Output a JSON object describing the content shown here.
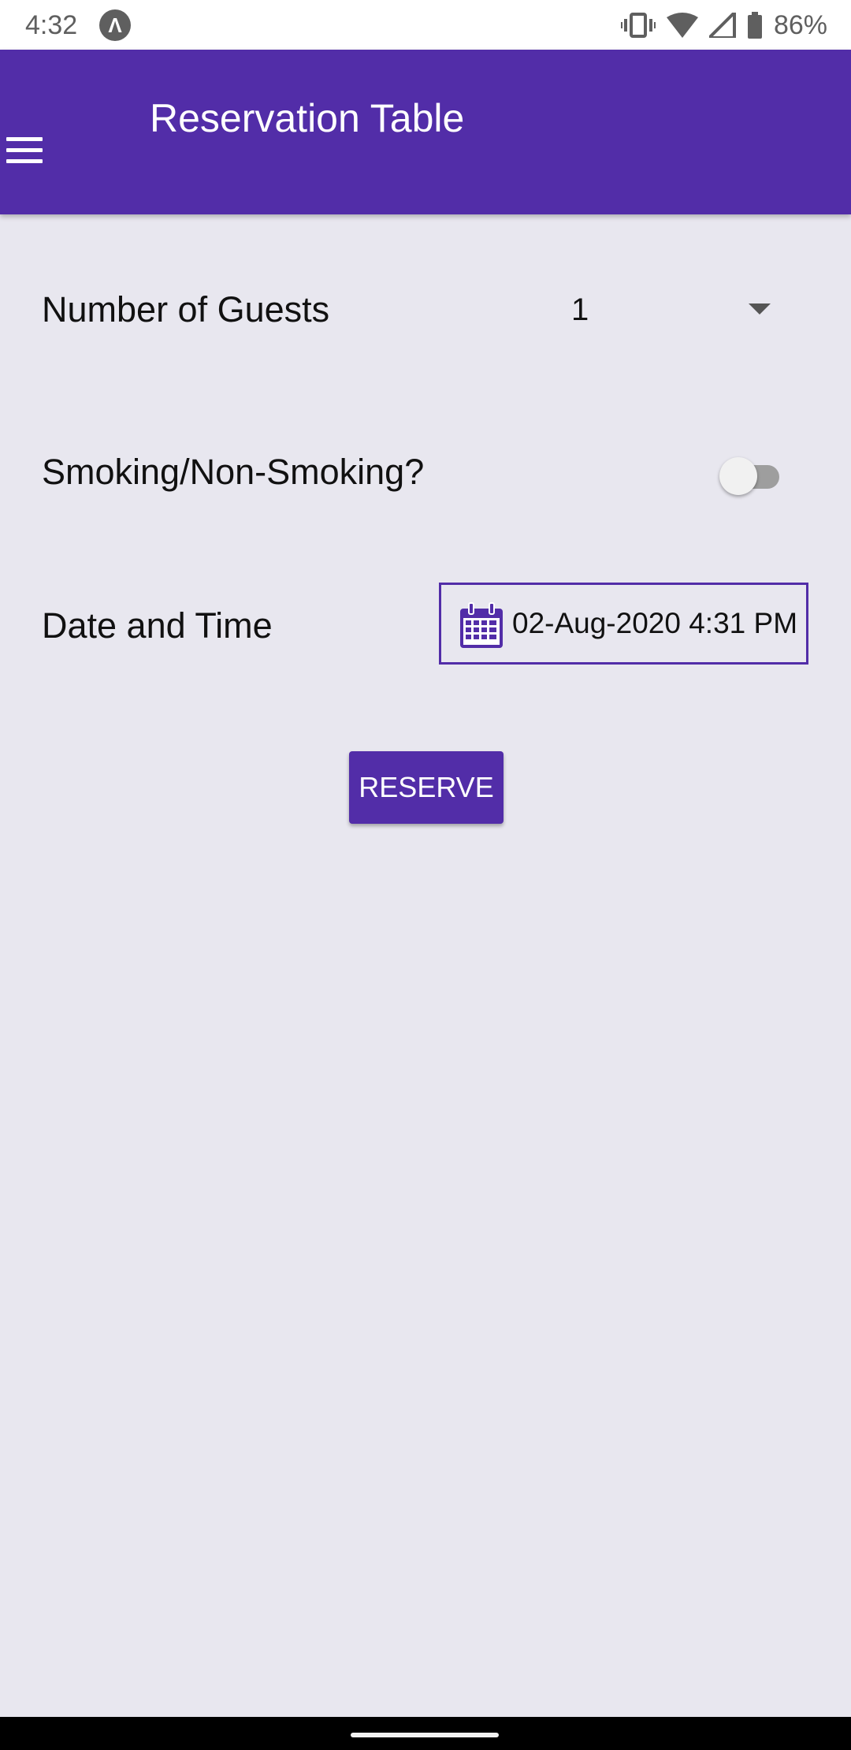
{
  "status_bar": {
    "time": "4:32",
    "app_icon_glyph": "Λ",
    "battery_percent": "86%",
    "icons": [
      "vibrate-icon",
      "wifi-icon",
      "signal-icon",
      "battery-icon"
    ]
  },
  "app_bar": {
    "title": "Reservation Table",
    "menu_icon": "hamburger-menu-icon",
    "background_color": "#522da8"
  },
  "form": {
    "guests": {
      "label": "Number of Guests",
      "selected_value": "1"
    },
    "smoking": {
      "label": "Smoking/Non-Smoking?",
      "checked": false
    },
    "datetime": {
      "label": "Date and Time",
      "value": "02-Aug-2020 4:31 PM",
      "icon": "calendar-icon"
    },
    "reserve_label": "RESERVE"
  },
  "colors": {
    "accent": "#522da8",
    "background": "#e8e7ef"
  }
}
